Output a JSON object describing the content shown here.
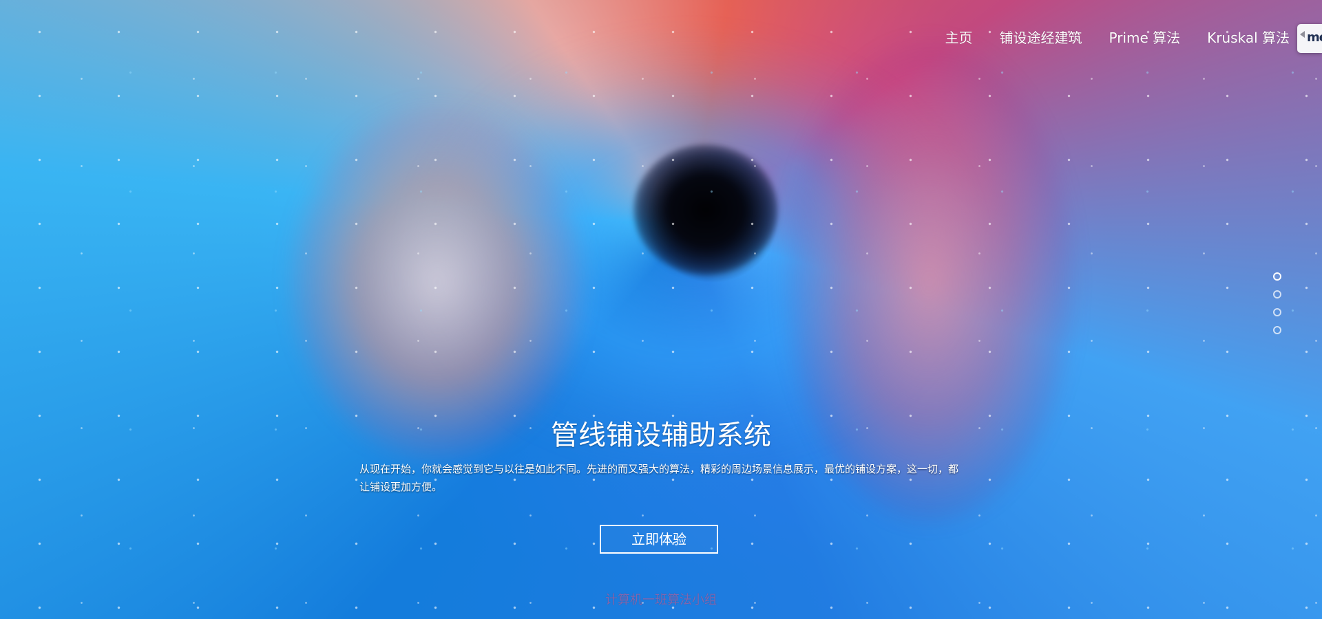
{
  "nav": {
    "items": [
      {
        "label": "主页"
      },
      {
        "label": "铺设途经建筑"
      },
      {
        "label": "Prime 算法"
      },
      {
        "label": "Kruskal 算法"
      }
    ],
    "user_chip_text": "me"
  },
  "hero": {
    "title": "管线铺设辅助系统",
    "description": "从现在开始，你就会感觉到它与以往是如此不同。先进的而又强大的算法，精彩的周边场景信息展示，最优的铺设方案，这一切，都让铺设更加方便。",
    "button_label": "立即体验"
  },
  "carousel": {
    "slide_count": 4,
    "active_index": 0
  },
  "footer": {
    "credit": "计算机一班算法小组"
  },
  "icons": {
    "user_chip": "collapse-arrow-icon",
    "slide_indicator": "circle-indicator-icon"
  },
  "colors": {
    "text": "#ffffff",
    "background_dark": "#05030c",
    "accent_blue": "#2a9cf5",
    "accent_pink": "#e95a84"
  }
}
